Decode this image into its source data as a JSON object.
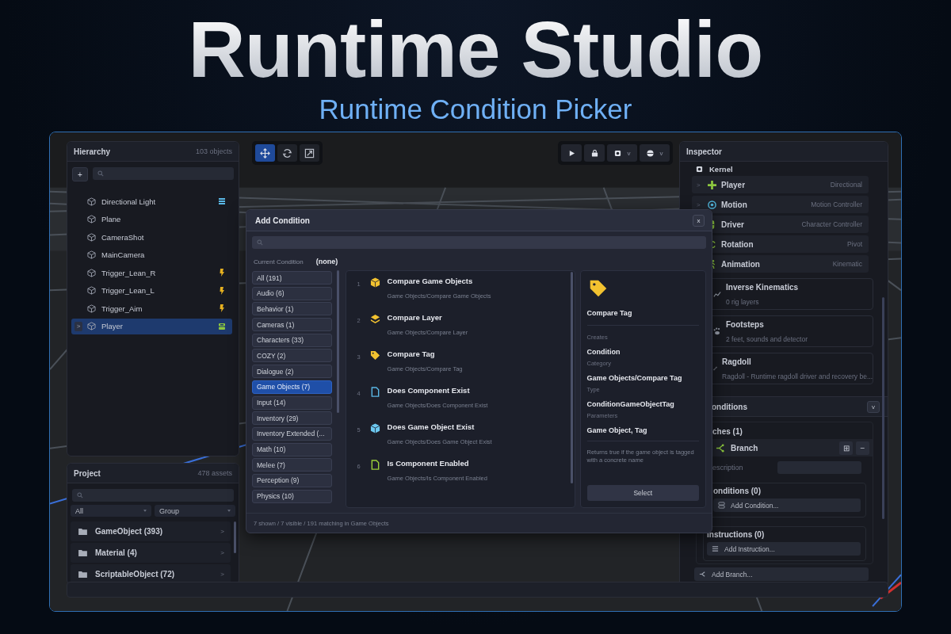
{
  "header": {
    "title": "Runtime Studio",
    "subtitle": "Runtime Condition Picker"
  },
  "hierarchy": {
    "title": "Hierarchy",
    "count": "103 objects",
    "add_button": "+",
    "items": [
      {
        "label": "Directional Light",
        "kind": "light",
        "selected": false
      },
      {
        "label": "Plane",
        "selected": false
      },
      {
        "label": "CameraShot",
        "selected": false
      },
      {
        "label": "MainCamera",
        "selected": false
      },
      {
        "label": "Trigger_Lean_R",
        "kind": "trigger",
        "selected": false
      },
      {
        "label": "Trigger_Lean_L",
        "kind": "trigger",
        "selected": false
      },
      {
        "label": "Trigger_Aim",
        "kind": "trigger",
        "selected": false
      },
      {
        "label": "Player",
        "kind": "player",
        "selected": true,
        "expander": ">"
      }
    ]
  },
  "project": {
    "title": "Project",
    "count": "478 assets",
    "filters": [
      "All",
      "Group"
    ],
    "folders": [
      {
        "label": "GameObject (393)",
        "chevron": ">"
      },
      {
        "label": "Material (4)",
        "chevron": ">"
      },
      {
        "label": "ScriptableObject (72)",
        "chevron": ">"
      }
    ]
  },
  "toolbar_left": [
    {
      "kind": "move",
      "selected": true
    },
    {
      "kind": "rotate",
      "selected": false
    },
    {
      "kind": "scale",
      "selected": false
    }
  ],
  "toolbar_right": [
    {
      "kind": "play"
    },
    {
      "kind": "lock"
    },
    {
      "kind": "gear",
      "caret": "v"
    },
    {
      "kind": "globe",
      "caret": "v"
    }
  ],
  "dialog": {
    "title": "Add Condition",
    "close": "x",
    "current_label": "Current Condition",
    "current_value": "(none)",
    "categories": [
      {
        "label": "All (191)",
        "selected": false
      },
      {
        "label": "Audio (6)",
        "selected": false
      },
      {
        "label": "Behavior (1)",
        "selected": false
      },
      {
        "label": "Cameras (1)",
        "selected": false
      },
      {
        "label": "Characters (33)",
        "selected": false
      },
      {
        "label": "COZY (2)",
        "selected": false
      },
      {
        "label": "Dialogue (2)",
        "selected": false
      },
      {
        "label": "Game Objects (7)",
        "selected": true
      },
      {
        "label": "Input (14)",
        "selected": false
      },
      {
        "label": "Inventory (29)",
        "selected": false
      },
      {
        "label": "Inventory Extended (...",
        "selected": false
      },
      {
        "label": "Math (10)",
        "selected": false
      },
      {
        "label": "Melee (7)",
        "selected": false
      },
      {
        "label": "Perception (9)",
        "selected": false
      },
      {
        "label": "Physics (10)",
        "selected": false
      }
    ],
    "results": [
      {
        "index": "1",
        "title": "Compare Game Objects",
        "path": "Game Objects/Compare Game Objects",
        "kind": "cube",
        "color": "#f2c230"
      },
      {
        "index": "2",
        "title": "Compare Layer",
        "path": "Game Objects/Compare Layer",
        "kind": "layers",
        "color": "#f2c230"
      },
      {
        "index": "3",
        "title": "Compare Tag",
        "path": "Game Objects/Compare Tag",
        "kind": "tag",
        "color": "#f2c230"
      },
      {
        "index": "4",
        "title": "Does Component Exist",
        "path": "Game Objects/Does Component Exist",
        "kind": "file",
        "color": "#5ab8e6"
      },
      {
        "index": "5",
        "title": "Does Game Object Exist",
        "path": "Game Objects/Does Game Object Exist",
        "kind": "cube",
        "color": "#6cc8f0"
      },
      {
        "index": "6",
        "title": "Is Component Enabled",
        "path": "Game Objects/Is Component Enabled",
        "kind": "file",
        "color": "#9bd13a"
      }
    ],
    "detail": {
      "kind": "tag",
      "color": "#f2c230",
      "title": "Compare Tag",
      "fields": [
        {
          "label": "Creates",
          "value": "Condition"
        },
        {
          "label": "Category",
          "value": "Game Objects/Compare Tag"
        },
        {
          "label": "Type",
          "value": "ConditionGameObjectTag"
        },
        {
          "label": "Parameters",
          "value": "Game Object, Tag"
        }
      ],
      "description": "Returns true if the game object is tagged with a concrete name",
      "button": "Select"
    },
    "footer": "7 shown / 7 visible / 191 matching in Game Objects"
  },
  "inspector": {
    "title": "Inspector",
    "kernel": "Kernel",
    "rows": [
      {
        "kind": "dpad",
        "label": "Player",
        "value": "Directional",
        "chevron": ">"
      },
      {
        "kind": "gear",
        "label": "Motion",
        "value": "Motion Controller",
        "chevron": ">"
      },
      {
        "kind": "capsule",
        "label": "Driver",
        "value": "Character Controller"
      },
      {
        "kind": "rotate",
        "label": "Rotation",
        "value": "Pivot"
      },
      {
        "kind": "runner",
        "label": "Animation",
        "value": "Kinematic"
      }
    ],
    "cards": [
      {
        "kind": "chart",
        "title": "Inverse Kinematics",
        "subtitle": "0 rig layers"
      },
      {
        "kind": "paw",
        "title": "Footsteps",
        "subtitle": "2 feet, sounds and detector"
      },
      {
        "kind": "bone",
        "title": "Ragdoll",
        "subtitle": "Ragdoll - Runtime ragdoll driver and recovery be..."
      }
    ],
    "conditions_title": "onditions",
    "conditions_toggle": "v",
    "branches_label": "ches (1)",
    "branch": {
      "label": "Branch",
      "add": "⊞",
      "remove": "−"
    },
    "description_label": "escription",
    "branch_conditions": "onditions (0)",
    "add_condition": "Add Condition...",
    "instructions": "Instructions (0)",
    "add_instruction": "Add Instruction...",
    "add_branch": "Add Branch..."
  }
}
